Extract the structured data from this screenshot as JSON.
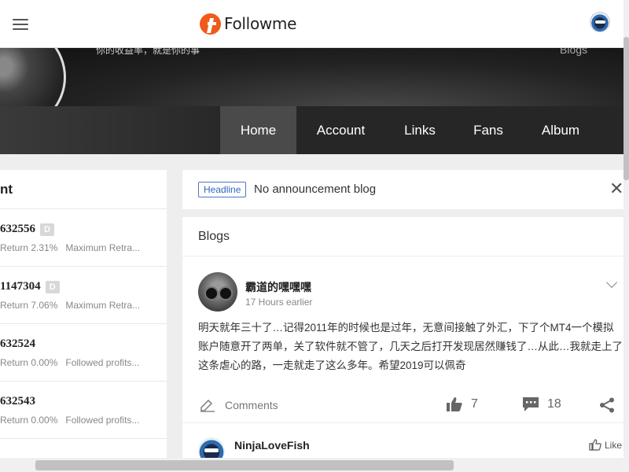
{
  "header": {
    "logo_text": "Followme"
  },
  "hero": {
    "signature": "你的收益率，就是你的事",
    "blogs_label": "Blogs"
  },
  "nav": {
    "items": [
      {
        "label": "Home",
        "active": true
      },
      {
        "label": "Account"
      },
      {
        "label": "Links"
      },
      {
        "label": "Fans"
      },
      {
        "label": "Album"
      }
    ]
  },
  "accounts_panel": {
    "title": "nt",
    "accounts": [
      {
        "number": "632556",
        "badge": "D",
        "return": "Return 2.31%",
        "metric": "Maximum Retra..."
      },
      {
        "number": "1147304",
        "badge": "D",
        "return": "Return 7.06%",
        "metric": "Maximum Retra..."
      },
      {
        "number": "632524",
        "badge": "",
        "return": "Return 0.00%",
        "metric": "Followed profits..."
      },
      {
        "number": "632543",
        "badge": "",
        "return": "Return 0.00%",
        "metric": "Followed profits..."
      }
    ]
  },
  "headline": {
    "badge": "Headline",
    "text": "No announcement blog",
    "close_glyph": "✕"
  },
  "blogs": {
    "title": "Blogs",
    "post": {
      "author": "霸道的嘿嘿嘿",
      "time": "17 Hours earlier",
      "body": "明天就年三十了…记得2011年的时候也是过年，无意间接触了外汇，下了个MT4一个模拟账户随意开了两单，关了软件就不管了，几天之后打开发现居然赚钱了…从此…我就走上了这条虐心的路，一走就走了这么多年。希望2019可以佩奇",
      "comments_label": "Comments",
      "likes": "7",
      "comment_count": "18"
    },
    "post2": {
      "author": "NinjaLoveFish",
      "like_label": "Like"
    }
  }
}
